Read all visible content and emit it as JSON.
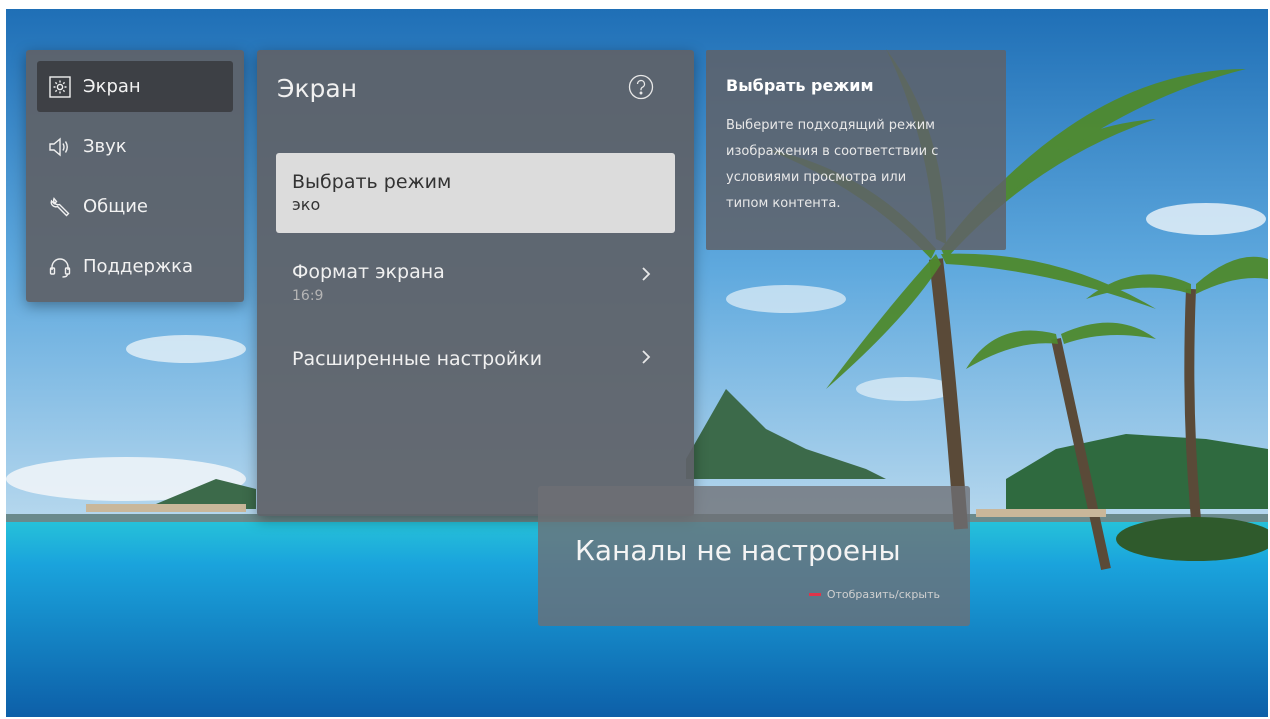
{
  "sidebar": {
    "items": [
      {
        "label": "Экран",
        "icon": "picture-icon",
        "active": true
      },
      {
        "label": "Звук",
        "icon": "speaker-icon",
        "active": false
      },
      {
        "label": "Общие",
        "icon": "wrench-icon",
        "active": false
      },
      {
        "label": "Поддержка",
        "icon": "headset-icon",
        "active": false
      }
    ]
  },
  "panel": {
    "title": "Экран",
    "help_icon": "help-icon",
    "options": [
      {
        "label": "Выбрать режим",
        "value": "эко",
        "selected": true
      },
      {
        "label": "Формат экрана",
        "value": "16:9",
        "selected": false,
        "has_submenu": true
      },
      {
        "label": "Расширенные настройки",
        "selected": false,
        "has_submenu": true
      }
    ]
  },
  "help": {
    "title": "Выбрать режим",
    "lines": [
      "Выберите подходящий режим",
      "изображения в соответствии с",
      "условиями просмотра или",
      "типом контента."
    ]
  },
  "channels": {
    "message": "Каналы не настроены",
    "hint": "Отобразить/скрыть",
    "hint_color": "#e0344a"
  }
}
